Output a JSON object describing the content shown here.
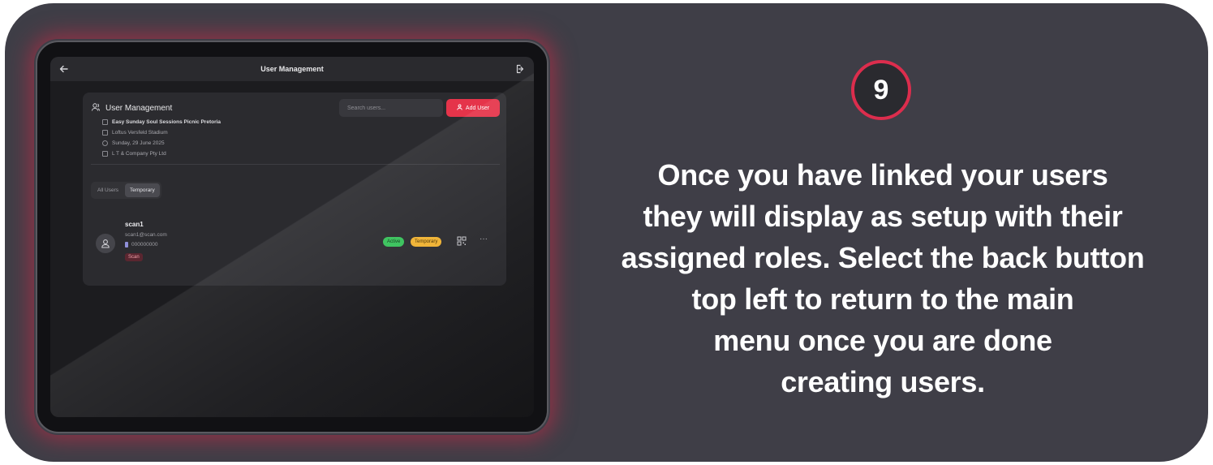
{
  "app": {
    "window_title": "User Management",
    "panel_title": "User Management",
    "event": {
      "name": "Easy Sunday Soul Sessions Picnic Pretoria",
      "venue": "Loftus Versfeld Stadium",
      "date": "Sunday, 29 June 2025",
      "company": "L T & Company Pty Ltd"
    },
    "search": {
      "placeholder": "Search users..."
    },
    "add_user_label": "Add User",
    "tabs": [
      {
        "label": "All Users",
        "active": false
      },
      {
        "label": "Temporary",
        "active": true
      }
    ],
    "users": [
      {
        "name": "scan1",
        "email": "scan1@scan.com",
        "phone": "000000000",
        "role": "Scan",
        "status": "Active",
        "type": "Temporary"
      }
    ]
  },
  "step": {
    "number": "9"
  },
  "instruction": {
    "lines": [
      "Once you have linked your users",
      "they will display as setup with their",
      "assigned roles. Select the back button",
      "top left to return to the main",
      "menu once you are done",
      "creating users."
    ]
  },
  "colors": {
    "background": "#3f3e47",
    "accent": "#dc2d4d",
    "add_button": "#e5344a",
    "active_badge": "#37c15a",
    "temporary_badge": "#f0b232"
  }
}
